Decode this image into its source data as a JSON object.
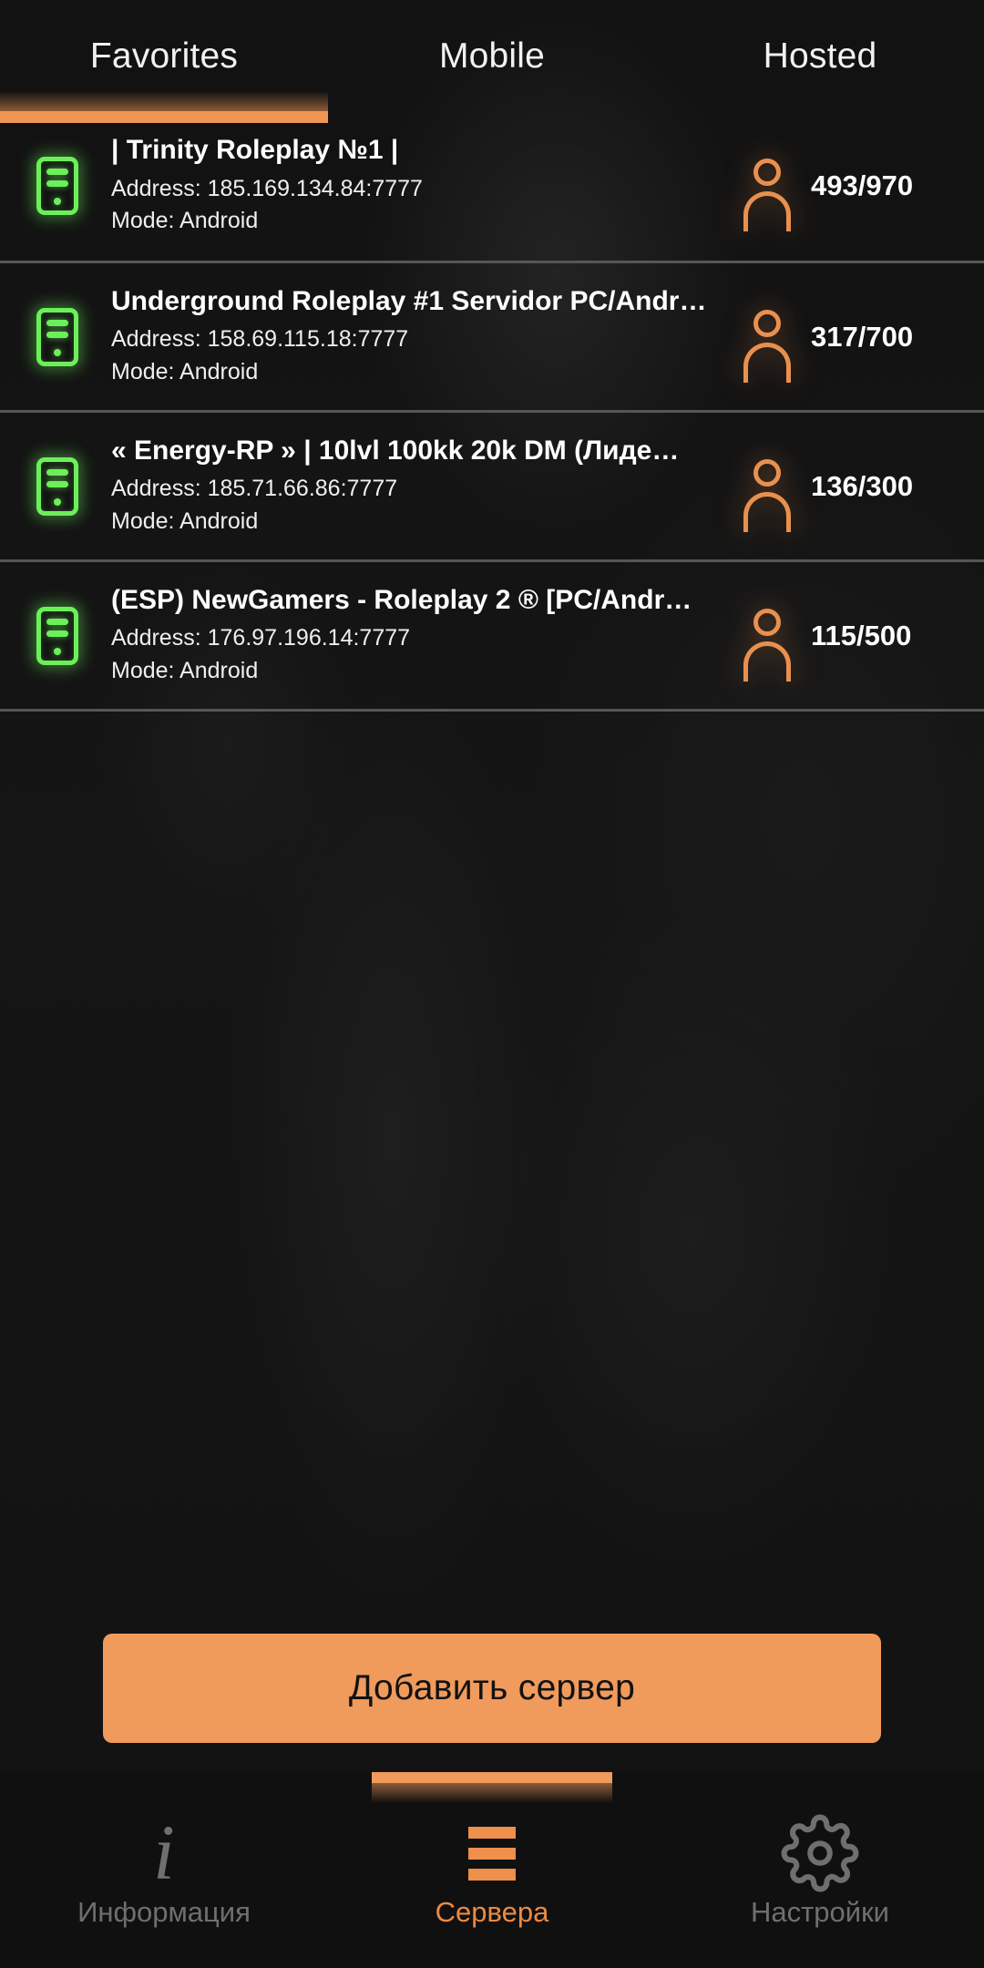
{
  "theme": {
    "accent": "#f09a5c",
    "accent_text": "#ec8a43",
    "background": "#131313",
    "nav_background": "#101010",
    "online_green": "#6cf05a",
    "player_orange": "#e9904e",
    "divider": "#56565a",
    "dim_text": "#6f6f6f"
  },
  "top_tabs": {
    "items": [
      {
        "label": "Favorites",
        "active": true
      },
      {
        "label": "Mobile",
        "active": false
      },
      {
        "label": "Hosted",
        "active": false
      }
    ]
  },
  "server_list": {
    "rows": [
      {
        "icon": "server-tower-icon",
        "status": "online",
        "name": "|     Trinity Roleplay  №1     |",
        "address": "Address: 185.169.134.84:7777",
        "mode": "Mode: Android",
        "players": "493/970",
        "players_current": 493,
        "players_max": 970
      },
      {
        "icon": "server-tower-icon",
        "status": "online",
        "name": "Underground Roleplay #1 Servidor PC/Andr…",
        "address": "Address: 158.69.115.18:7777",
        "mode": "Mode: Android",
        "players": "317/700",
        "players_current": 317,
        "players_max": 700
      },
      {
        "icon": "server-tower-icon",
        "status": "online",
        "name": "« Energy-RP » | 10lvl 100kk 20k DM (Лиде…",
        "address": "Address: 185.71.66.86:7777",
        "mode": "Mode: Android",
        "players": "136/300",
        "players_current": 136,
        "players_max": 300
      },
      {
        "icon": "server-tower-icon",
        "status": "online",
        "name": "(ESP) NewGamers - Roleplay 2 ® [PC/Andr…",
        "address": "Address: 176.97.196.14:7777",
        "mode": "Mode: Android",
        "players": "115/500",
        "players_current": 115,
        "players_max": 500
      }
    ]
  },
  "add_server_button": {
    "label": "Добавить сервер"
  },
  "bottom_nav": {
    "items": [
      {
        "label": "Информация",
        "icon": "info-icon",
        "active": false
      },
      {
        "label": "Сервера",
        "icon": "menu-icon",
        "active": true
      },
      {
        "label": "Настройки",
        "icon": "gear-icon",
        "active": false
      }
    ]
  }
}
